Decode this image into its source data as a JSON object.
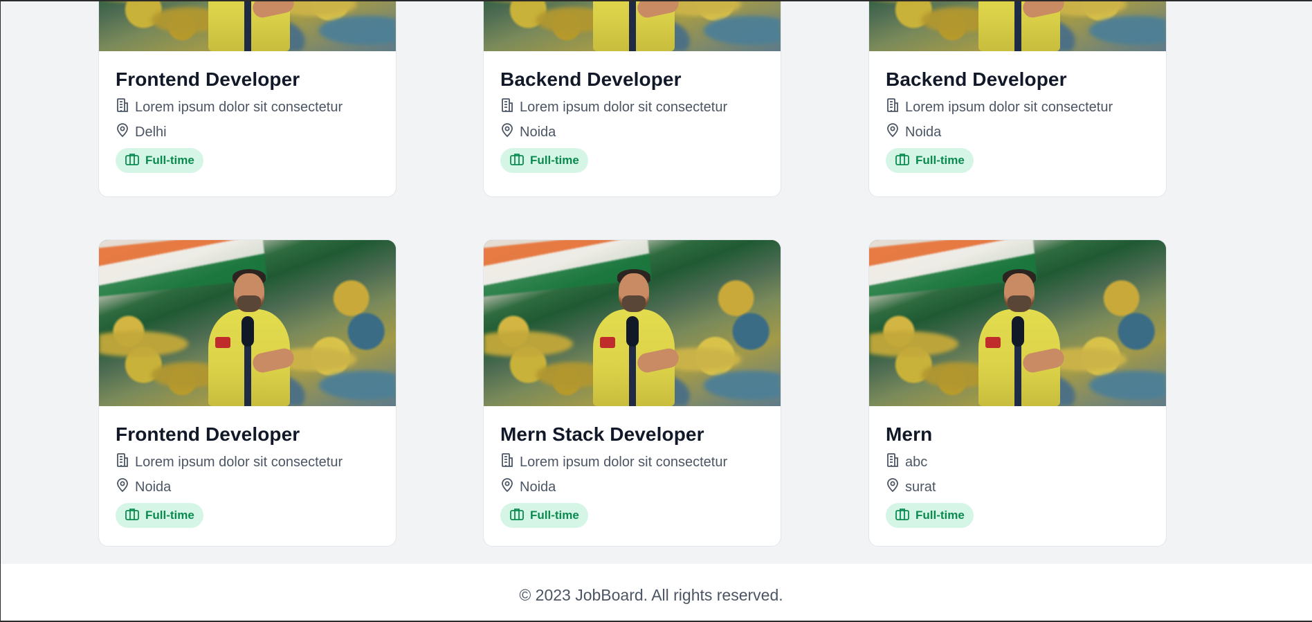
{
  "jobs": [
    {
      "title": "Frontend Developer",
      "company": "Lorem ipsum dolor sit consectetur",
      "location": "Delhi",
      "type": "Full-time"
    },
    {
      "title": "Backend Developer",
      "company": "Lorem ipsum dolor sit consectetur",
      "location": "Noida",
      "type": "Full-time"
    },
    {
      "title": "Backend Developer",
      "company": "Lorem ipsum dolor sit consectetur",
      "location": "Noida",
      "type": "Full-time"
    },
    {
      "title": "Frontend Developer",
      "company": "Lorem ipsum dolor sit consectetur",
      "location": "Noida",
      "type": "Full-time"
    },
    {
      "title": "Mern Stack Developer",
      "company": "Lorem ipsum dolor sit consectetur",
      "location": "Noida",
      "type": "Full-time"
    },
    {
      "title": "Mern",
      "company": "abc",
      "location": "surat",
      "type": "Full-time"
    }
  ],
  "footer": {
    "text": "© 2023 JobBoard. All rights reserved."
  },
  "icons": {
    "company": "building-icon",
    "location": "map-pin-icon",
    "job_type": "briefcase-icon"
  },
  "colors": {
    "page_bg": "#f2f3f5",
    "card_bg": "#ffffff",
    "title": "#111827",
    "meta": "#4b5563",
    "badge_bg": "#d5f6e6",
    "badge_text": "#0a8a4f"
  }
}
